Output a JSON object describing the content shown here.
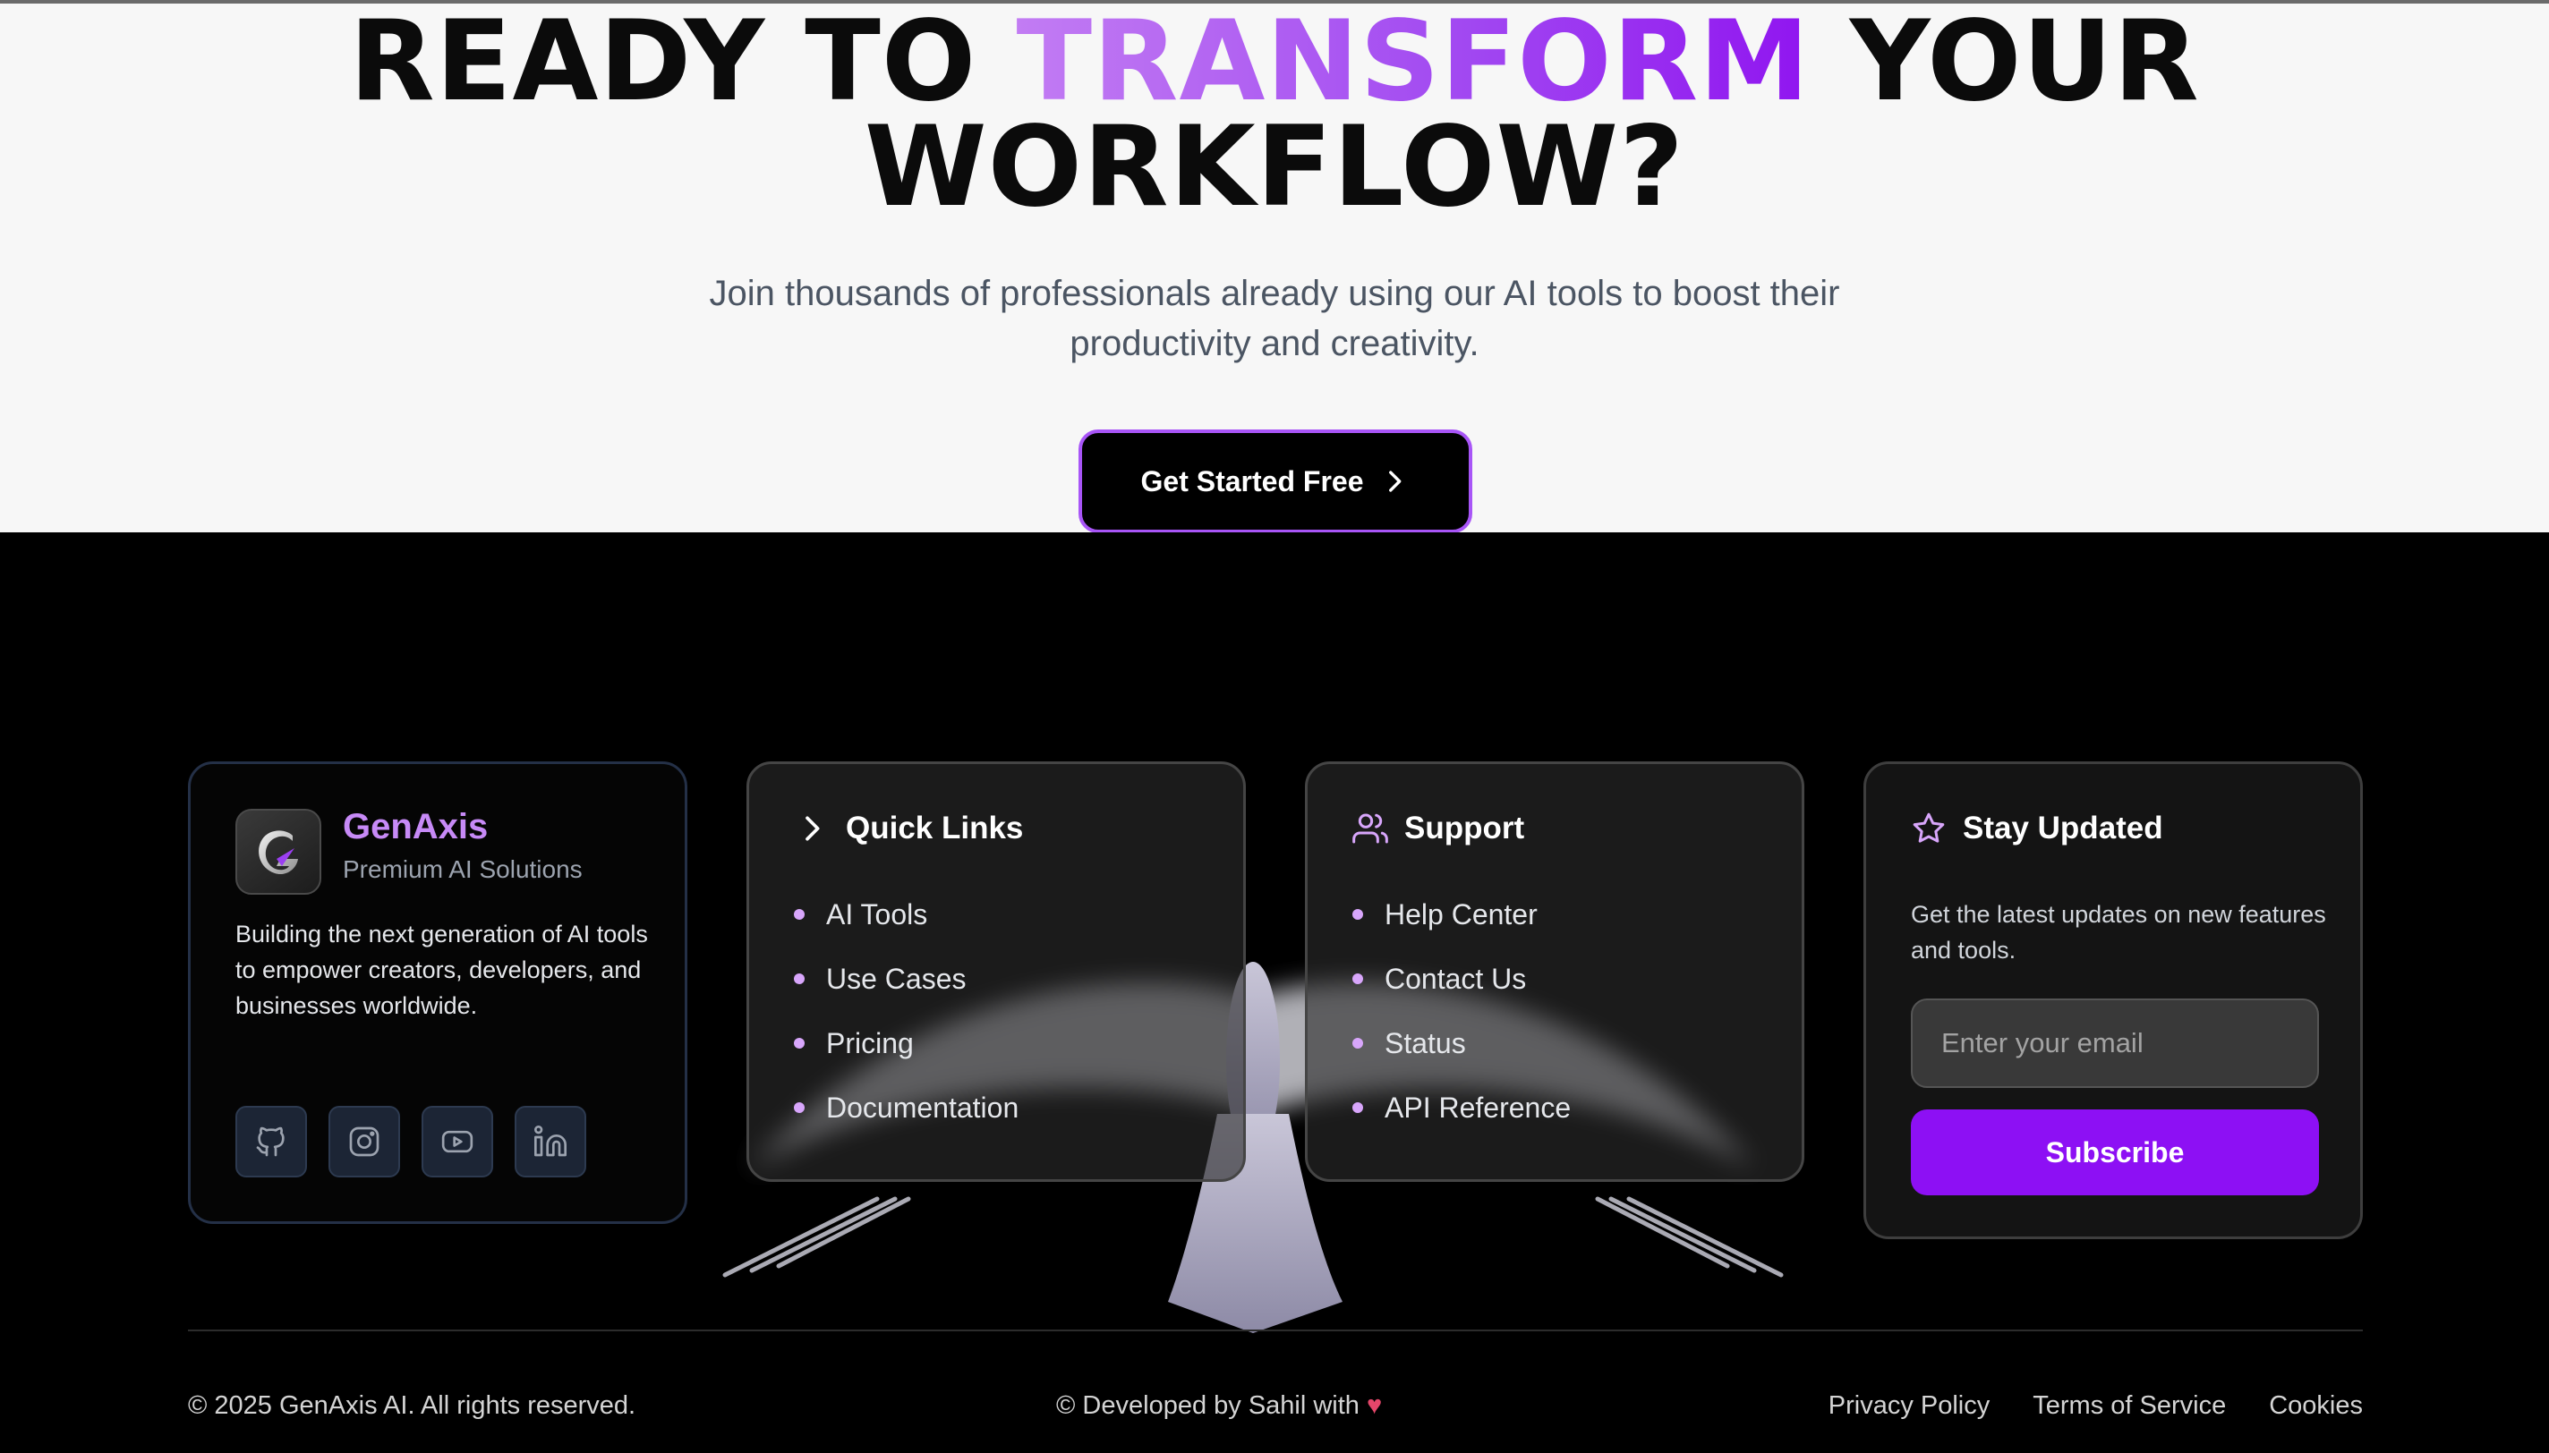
{
  "cta": {
    "title_part1": "READY TO ",
    "title_accent": "TRANSFORM",
    "title_part2": " YOUR",
    "title_line2": "WORKFLOW?",
    "subtitle_line1": "Join thousands of professionals already using our AI tools to boost their",
    "subtitle_line2": "productivity and creativity.",
    "button_label": "Get Started Free",
    "button_icon": "chevron-right-icon"
  },
  "brand": {
    "name": "GenAxis",
    "tagline": "Premium AI Solutions",
    "description": "Building the next generation of AI tools to empower creators, developers, and businesses worldwide.",
    "socials": [
      "github-icon",
      "instagram-icon",
      "youtube-icon",
      "linkedin-icon"
    ]
  },
  "quick_links": {
    "title": "Quick Links",
    "icon": "chevron-right-icon",
    "items": [
      "AI Tools",
      "Use Cases",
      "Pricing",
      "Documentation"
    ]
  },
  "support": {
    "title": "Support",
    "icon": "users-icon",
    "items": [
      "Help Center",
      "Contact Us",
      "Status",
      "API Reference"
    ]
  },
  "newsletter": {
    "title": "Stay Updated",
    "icon": "star-icon",
    "description": "Get the latest updates on new features and tools.",
    "email_placeholder": "Enter your email",
    "button_label": "Subscribe"
  },
  "bottom": {
    "copyright": "© 2025 GenAxis AI. All rights reserved.",
    "developed_by": "© Developed by Sahil with",
    "heart": "♥",
    "legal": [
      "Privacy Policy",
      "Terms of Service",
      "Cookies"
    ]
  },
  "colors": {
    "accent": "#9015f0",
    "accent_light": "#c78af7",
    "cta_background": "#f7f7f7",
    "footer_background": "#000000"
  }
}
